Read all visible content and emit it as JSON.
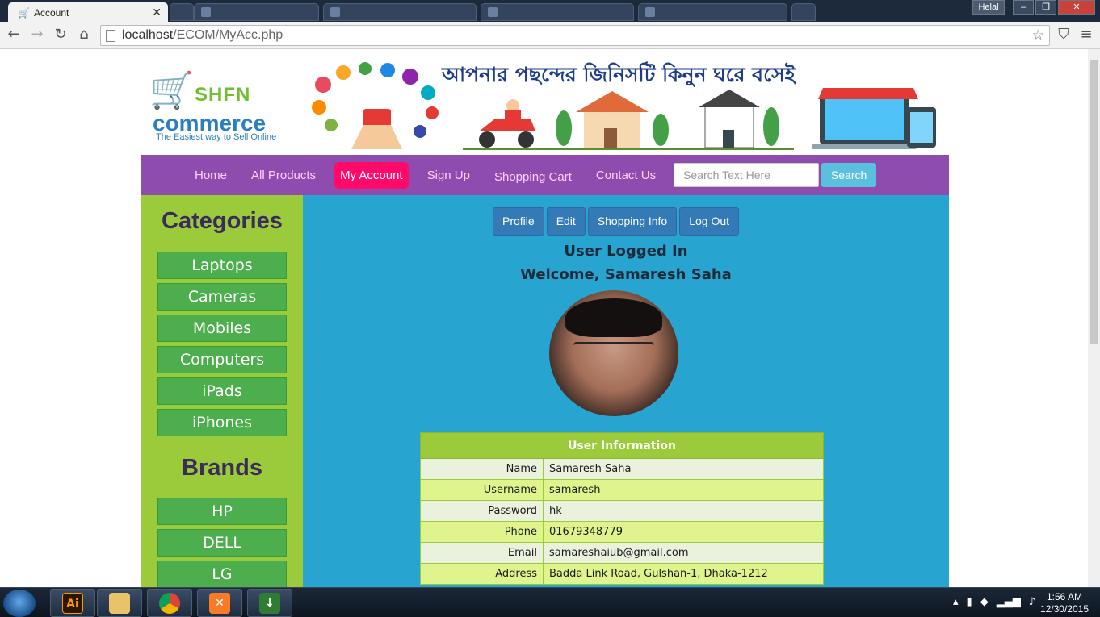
{
  "browser": {
    "tab_title": "Account",
    "tab_close": "✕",
    "url_host": "localhost",
    "url_path": "/ECOM/MyAcc.php",
    "user_badge": "Helal",
    "win_min": "–",
    "win_max": "❐",
    "win_close": "✕"
  },
  "banner": {
    "logo_top": "SHFN",
    "logo_main": "commerce",
    "logo_tagline": "The Easiest way to Sell Online",
    "slogan": "আপনার পছন্দের জিনিসটি কিনুন ঘরে বসেই"
  },
  "topnav": {
    "links": [
      "Home",
      "All Products",
      "My Account",
      "Sign Up",
      "Shopping Cart",
      "Contact Us"
    ],
    "active": "My Account",
    "search_placeholder": "Search Text Here",
    "search_button": "Search"
  },
  "sidebar": {
    "categories_title": "Categories",
    "categories": [
      "Laptops",
      "Cameras",
      "Mobiles",
      "Computers",
      "iPads",
      "iPhones"
    ],
    "brands_title": "Brands",
    "brands": [
      "HP",
      "DELL",
      "LG"
    ]
  },
  "account": {
    "tabs": [
      "Profile",
      "Edit",
      "Shopping Info",
      "Log Out"
    ],
    "status": "User Logged In",
    "welcome": "Welcome, Samaresh Saha",
    "table_title": "User Information",
    "rows": [
      {
        "label": "Name",
        "value": "Samaresh Saha"
      },
      {
        "label": "Username",
        "value": "samaresh"
      },
      {
        "label": "Password",
        "value": "hk"
      },
      {
        "label": "Phone",
        "value": "01679348779"
      },
      {
        "label": "Email",
        "value": "samareshaiub@gmail.com"
      },
      {
        "label": "Address",
        "value": "Badda Link Road, Gulshan-1, Dhaka-1212"
      }
    ]
  },
  "taskbar": {
    "apps": [
      "illustrator-icon",
      "file-explorer-icon",
      "chrome-icon",
      "xampp-icon",
      "download-manager-icon"
    ],
    "illustrator_label": "Ai",
    "time": "1:56 AM",
    "date": "12/30/2015"
  }
}
